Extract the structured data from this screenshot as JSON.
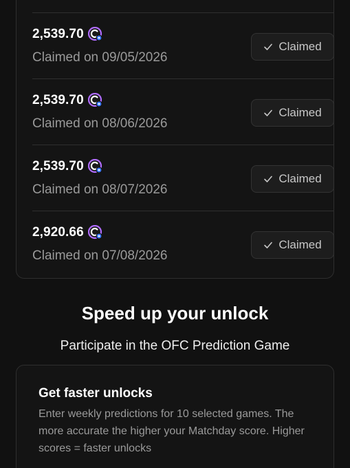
{
  "claims": [
    {
      "amount": "2,539.70",
      "date": "Claimed on 09/05/2026",
      "status": "Claimed"
    },
    {
      "amount": "2,539.70",
      "date": "Claimed on 08/06/2026",
      "status": "Claimed"
    },
    {
      "amount": "2,539.70",
      "date": "Claimed on 08/07/2026",
      "status": "Claimed"
    },
    {
      "amount": "2,920.66",
      "date": "Claimed on 07/08/2026",
      "status": "Claimed"
    }
  ],
  "speed_up": {
    "title": "Speed up your unlock",
    "subtitle": "Participate in the OFC Prediction Game"
  },
  "faster_card": {
    "title": "Get faster unlocks",
    "description": "Enter weekly predictions for 10 selected games. The more accurate the higher your Matchday score. Higher scores = faster unlocks"
  },
  "icons": {
    "coin": "ofc-token-icon",
    "check": "check-icon"
  },
  "colors": {
    "background": "#111111",
    "card_border": "#2e2e2e",
    "coin_accent": "#b06cff",
    "coin_dot": "#3d7bff",
    "muted_text": "#9a9a9a"
  }
}
